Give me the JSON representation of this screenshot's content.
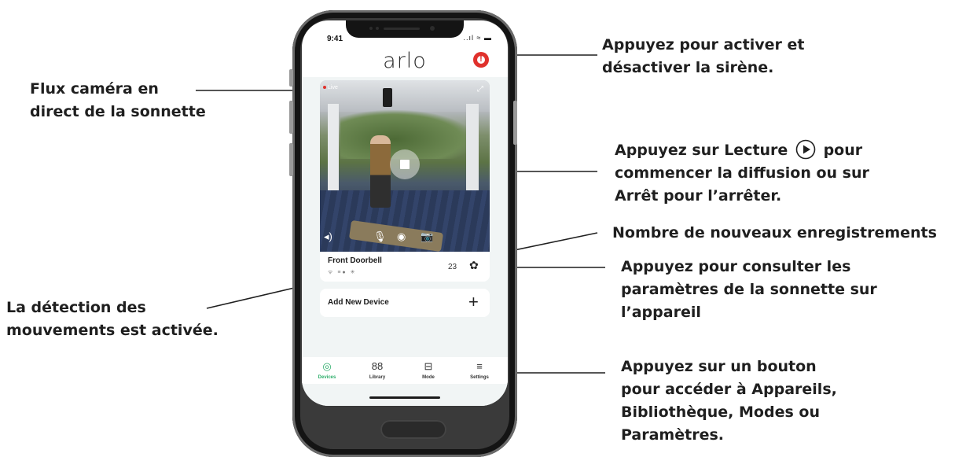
{
  "phone": {
    "status_time": "9:41",
    "status_icons": "..ıl ≈ ▬",
    "brand": "arlo",
    "camera": {
      "live_label": "Live",
      "expand_icon": "⤢",
      "controls": [
        "◂)",
        "🎙",
        "◉",
        "📷"
      ]
    },
    "device": {
      "name": "Front Doorbell",
      "status_icons": "ᯤ ≡● ✳",
      "recordings_count": "23",
      "settings_icon": "✿"
    },
    "add_device": {
      "label": "Add New Device",
      "plus": "+"
    },
    "tabs": [
      {
        "icon": "◎",
        "label": "Devices",
        "active": true
      },
      {
        "icon": "88",
        "label": "Library",
        "active": false
      },
      {
        "icon": "⊟",
        "label": "Mode",
        "active": false
      },
      {
        "icon": "≡",
        "label": "Settings",
        "active": false
      }
    ]
  },
  "callouts": {
    "siren": [
      "Appuyez pour activer et",
      "désactiver la sirène."
    ],
    "live_feed": [
      "Flux caméra en",
      "direct de la sonnette"
    ],
    "play": [
      "Appuyez sur Lecture",
      "commencer la diffusion ou sur",
      "Arrêt pour l’arrêter."
    ],
    "play_suffix": " pour",
    "recordings": [
      "Nombre de nouveaux enregistrements"
    ],
    "settings": [
      "Appuyez pour consulter les",
      "paramètres de la sonnette sur",
      "l’appareil"
    ],
    "motion": [
      "La détection des",
      "mouvements est activée."
    ],
    "tabs": [
      "Appuyez sur un bouton",
      "pour accéder à Appareils,",
      "Bibliothèque, Modes ou",
      "Paramètres."
    ]
  },
  "colors": {
    "accent_green": "#2eae6b",
    "siren_red": "#e0312c",
    "phone_body": "#3a3a3a"
  }
}
